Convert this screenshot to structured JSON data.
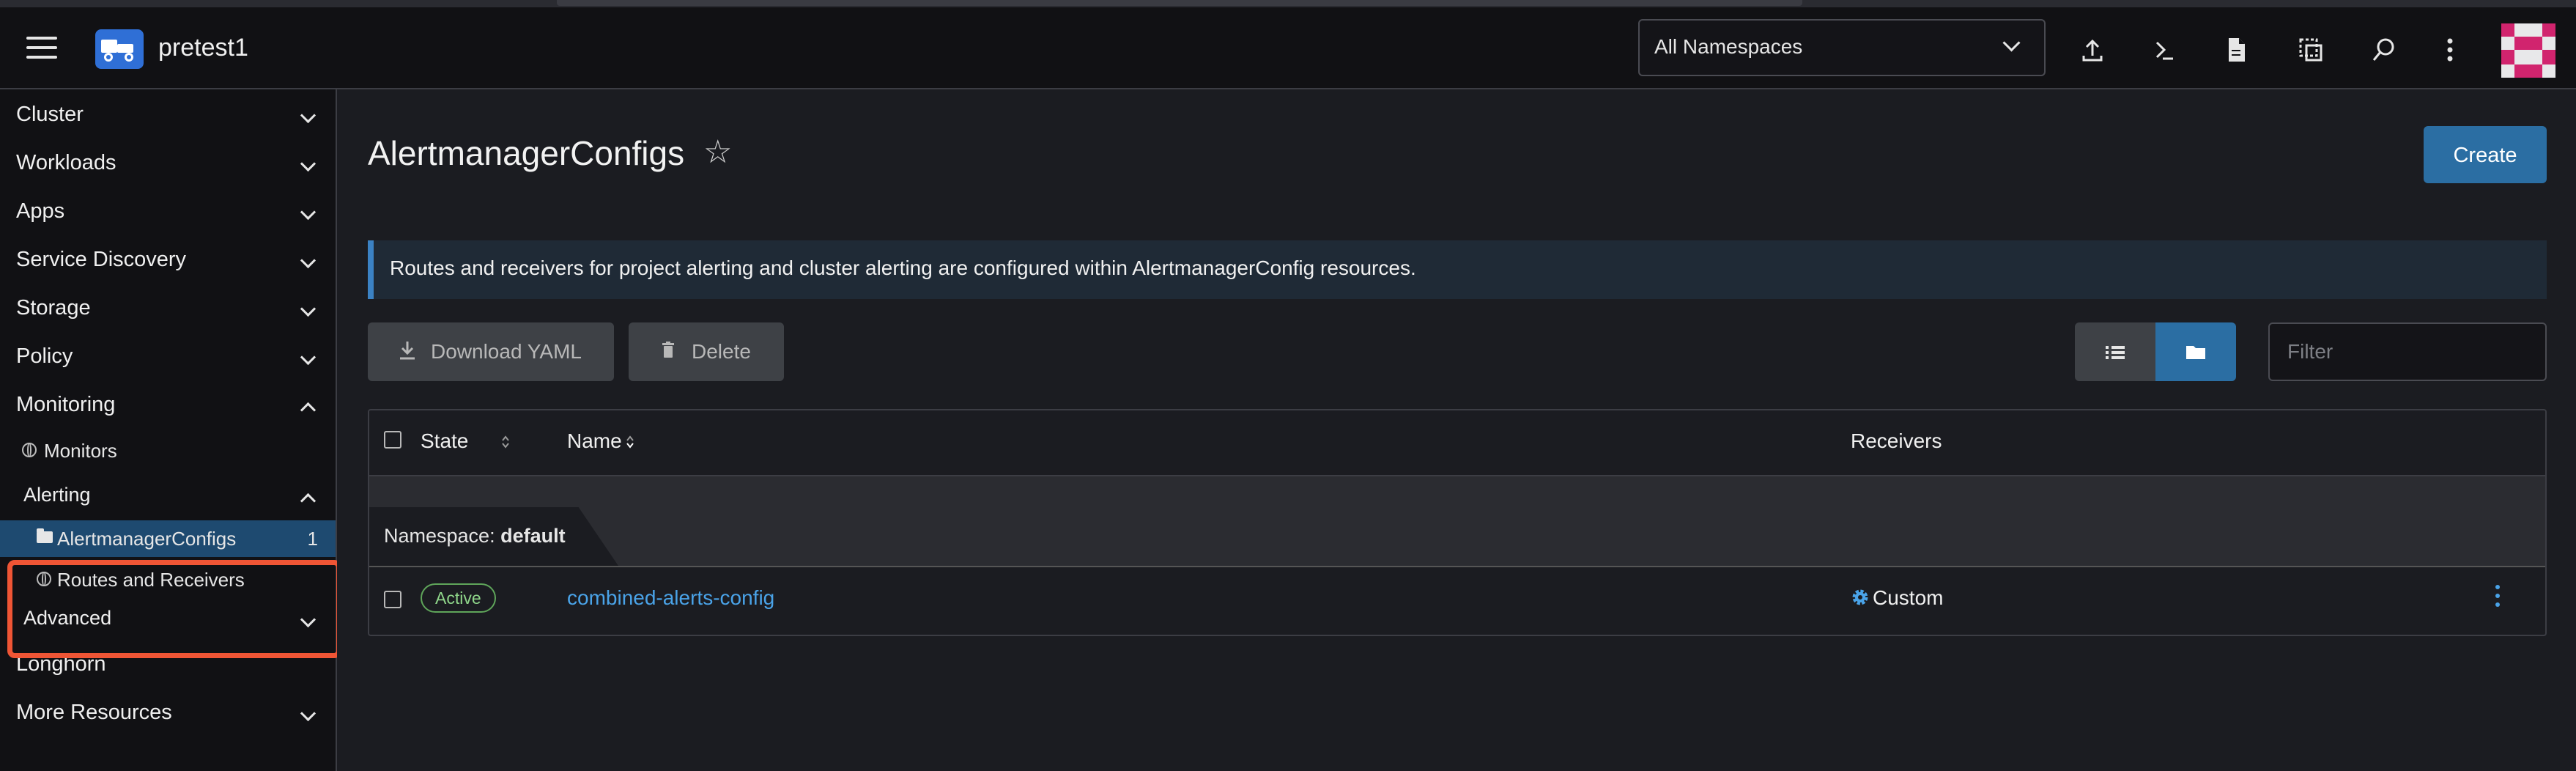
{
  "header": {
    "cluster_name": "pretest1",
    "namespace_selector": "All Namespaces"
  },
  "sidebar": {
    "groups": [
      {
        "label": "Cluster"
      },
      {
        "label": "Workloads"
      },
      {
        "label": "Apps"
      },
      {
        "label": "Service Discovery"
      },
      {
        "label": "Storage"
      },
      {
        "label": "Policy"
      },
      {
        "label": "Monitoring"
      }
    ],
    "monitors": "Monitors",
    "alerting": "Alerting",
    "alertmanager_configs": "AlertmanagerConfigs",
    "alertmanager_count": "1",
    "routes_receivers": "Routes and Receivers",
    "advanced": "Advanced",
    "longhorn": "Longhorn",
    "more_resources": "More Resources"
  },
  "main": {
    "title": "AlertmanagerConfigs",
    "create_label": "Create",
    "banner": "Routes and receivers for project alerting and cluster alerting are configured within AlertmanagerConfig resources.",
    "download_yaml": "Download YAML",
    "delete": "Delete",
    "filter_placeholder": "Filter",
    "columns": {
      "state": "State",
      "name": "Name",
      "receivers": "Receivers"
    },
    "group": {
      "prefix": "Namespace:",
      "value": "default"
    },
    "rows": [
      {
        "state": "Active",
        "name": "combined-alerts-config",
        "receivers": "Custom"
      }
    ]
  },
  "colors": {
    "accent": "#2b6ea3",
    "link": "#4aa3e8",
    "highlight": "#ef5535",
    "active_badge": "#5fa55a"
  }
}
